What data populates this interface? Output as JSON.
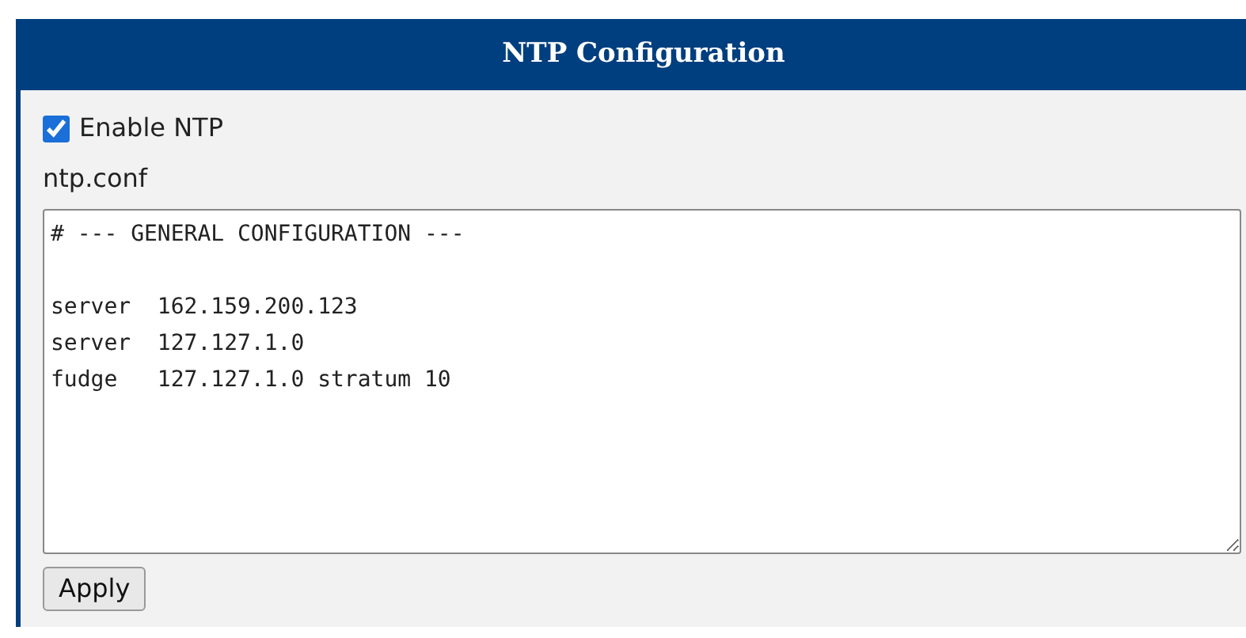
{
  "panel": {
    "title": "NTP Configuration"
  },
  "enable": {
    "label": "Enable NTP",
    "checked": true
  },
  "file_label": "ntp.conf",
  "config_text": "# --- GENERAL CONFIGURATION ---\n\nserver  162.159.200.123\nserver  127.127.1.0\nfudge   127.127.1.0 stratum 10",
  "buttons": [
    "Apply"
  ]
}
